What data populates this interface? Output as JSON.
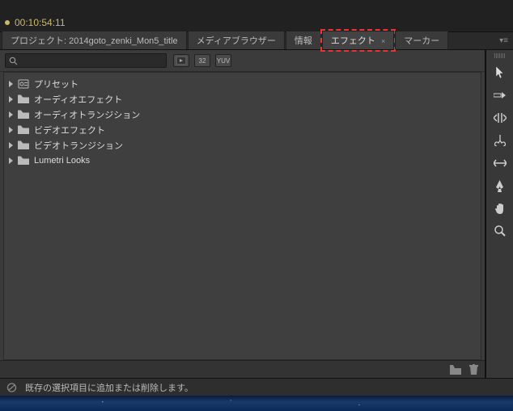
{
  "timecode": "00:10:54:11",
  "tabs": {
    "project": "プロジェクト: 2014goto_zenki_Mon5_title",
    "media_browser": "メディアブラウザー",
    "info": "情報",
    "effects": "エフェクト",
    "markers": "マーカー"
  },
  "search": {
    "placeholder": ""
  },
  "filter_badges": {
    "fx": "fx",
    "b32": "32",
    "yuv": "YUV"
  },
  "tree": [
    {
      "label": "プリセット",
      "icon": "preset"
    },
    {
      "label": "オーディオエフェクト",
      "icon": "folder"
    },
    {
      "label": "オーディオトランジション",
      "icon": "folder"
    },
    {
      "label": "ビデオエフェクト",
      "icon": "folder"
    },
    {
      "label": "ビデオトランジション",
      "icon": "folder"
    },
    {
      "label": "Lumetri Looks",
      "icon": "folder"
    }
  ],
  "status": "既存の選択項目に追加または削除します。"
}
